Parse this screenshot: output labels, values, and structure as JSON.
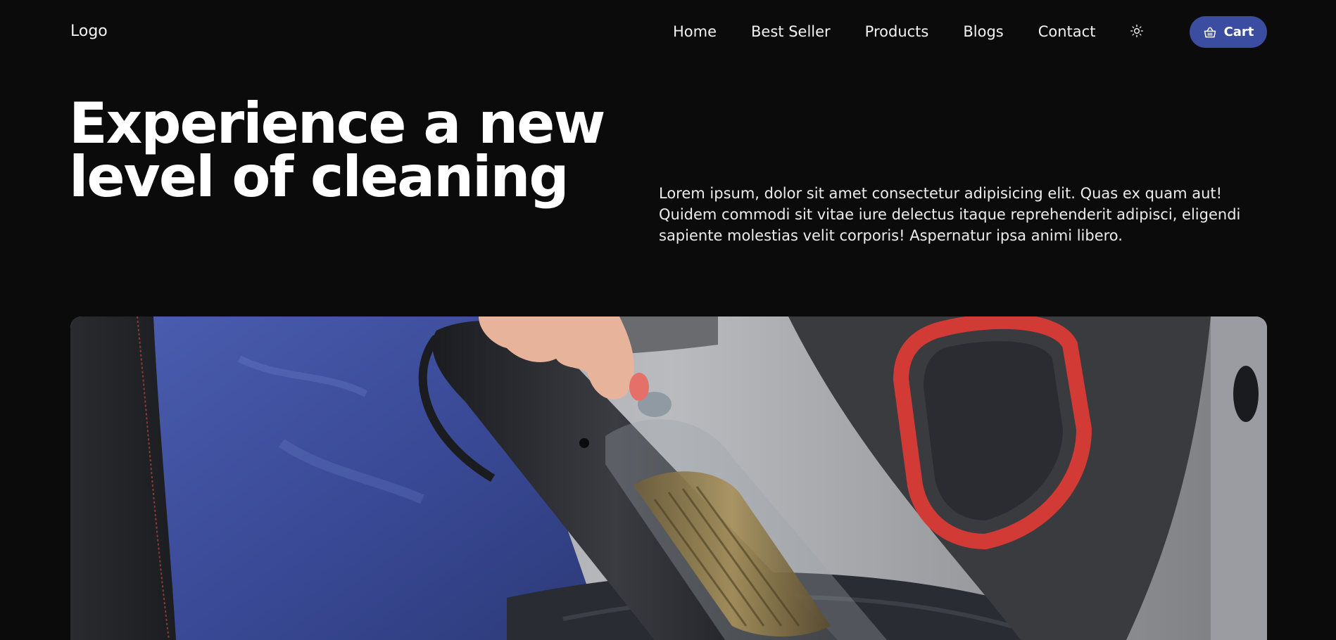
{
  "header": {
    "logo_text": "Logo",
    "nav": [
      {
        "label": "Home"
      },
      {
        "label": "Best Seller"
      },
      {
        "label": "Products"
      },
      {
        "label": "Blogs"
      },
      {
        "label": "Contact"
      }
    ],
    "theme_toggle_icon": "sun-icon",
    "cart": {
      "label": "Cart",
      "icon": "basket-icon",
      "color": "#3b4da0"
    }
  },
  "hero": {
    "title_line_1": "Experience a new",
    "title_line_2": "level of cleaning",
    "description": "Lorem ipsum, dolor sit amet consectetur adipisicing elit. Quas ex quam aut! Quidem commodi sit vitae iure delectus itaque reprehenderit adipisci, eligendi sapiente molestias velit corporis! Aspernatur ipsa animi libero."
  },
  "colors": {
    "background": "#0b0b0b",
    "text": "#ffffff",
    "accent": "#3b4da0"
  }
}
